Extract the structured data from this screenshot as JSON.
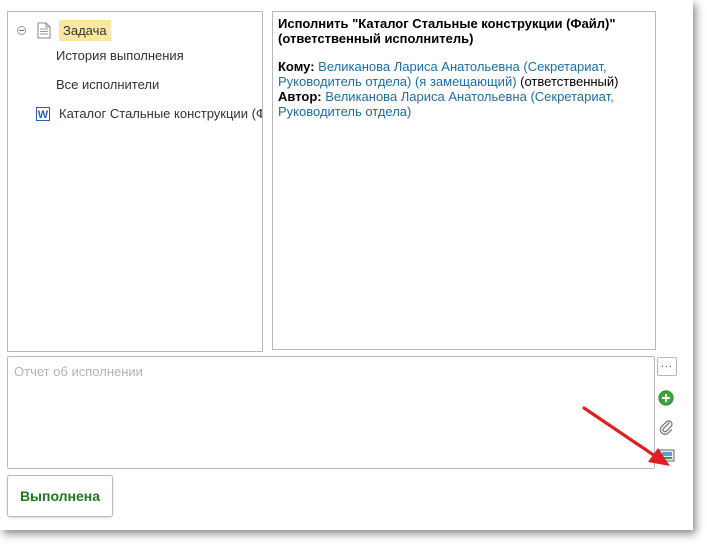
{
  "tree": {
    "items": [
      {
        "label": "Задача"
      },
      {
        "label": "История выполнения"
      },
      {
        "label": "Все исполнители"
      },
      {
        "label": "Каталог Стальные конструкции (Файл)"
      }
    ]
  },
  "info": {
    "title": "Исполнить \"Каталог Стальные конструкции (Файл)\" (ответственный исполнитель)",
    "to_label": "Кому:",
    "to_link": "Великанова Лариса Анатольевна (Секретариат, Руководитель отдела) (я замещающий)",
    "to_suffix": " (ответственный)",
    "author_label": "Автор:",
    "author_link": "Великанова Лариса Анатольевна (Секретариат, Руководитель отдела)"
  },
  "report": {
    "placeholder": "Отчет об исполнении",
    "value": ""
  },
  "side_buttons": {
    "more_label": "...",
    "icons": [
      "add-icon",
      "paperclip-icon",
      "scan-icon"
    ]
  },
  "annotation": {
    "color": "#e02020"
  },
  "actions": {
    "done_label": "Выполнена",
    "done_color": "#1e7a1e"
  }
}
